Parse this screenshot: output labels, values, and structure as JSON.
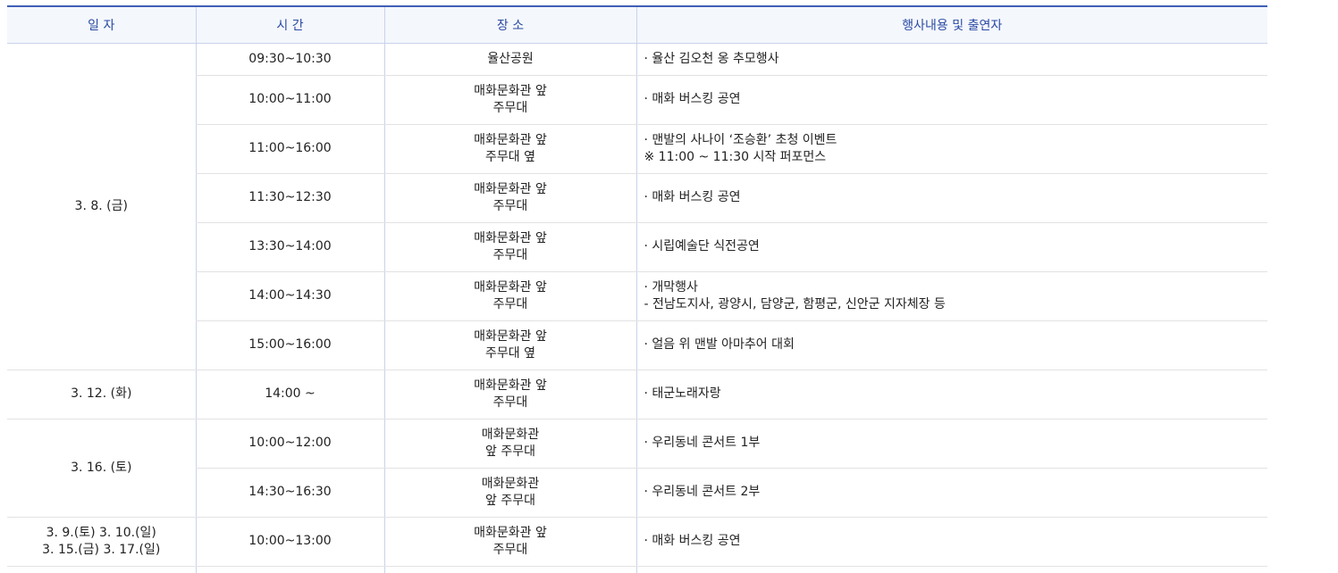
{
  "header": {
    "date": "일 자",
    "time": "시 간",
    "place": "장 소",
    "event": "행사내용 및 출연자"
  },
  "rows": [
    {
      "date": "3. 8. (금)",
      "time": "09:30~10:30",
      "place": [
        "율산공원"
      ],
      "event": [
        "· 율산 김오천 옹 추모행사"
      ]
    },
    {
      "time": "10:00~11:00",
      "place": [
        "매화문화관 앞",
        "주무대"
      ],
      "event": [
        "· 매화 버스킹 공연"
      ]
    },
    {
      "time": "11:00~16:00",
      "place": [
        "매화문화관 앞",
        "주무대 옆"
      ],
      "event": [
        "· 맨발의 사나이 ‘조승환’ 초청 이벤트",
        "※ 11:00 ~ 11:30 시작 퍼포먼스"
      ]
    },
    {
      "time": "11:30~12:30",
      "place": [
        "매화문화관 앞",
        "주무대"
      ],
      "event": [
        "· 매화 버스킹 공연"
      ]
    },
    {
      "time": "13:30~14:00",
      "place": [
        "매화문화관 앞",
        "주무대"
      ],
      "event": [
        "· 시립예술단 식전공연"
      ]
    },
    {
      "time": "14:00~14:30",
      "place": [
        "매화문화관 앞",
        "주무대"
      ],
      "event": [
        "· 개막행사",
        "- 전남도지사, 광양시, 담양군, 함평군, 신안군 지자체장 등"
      ]
    },
    {
      "time": "15:00~16:00",
      "place": [
        "매화문화관 앞",
        "주무대 옆"
      ],
      "event": [
        "· 얼음 위 맨발 아마추어 대회"
      ]
    },
    {
      "date": "3. 12. (화)",
      "time": "14:00 ~",
      "place": [
        "매화문화관 앞",
        "주무대"
      ],
      "event": [
        "· 태군노래자랑"
      ]
    },
    {
      "date": "3. 16. (토)",
      "time": "10:00~12:00",
      "place": [
        "매화문화관",
        "앞 주무대"
      ],
      "event": [
        "· 우리동네 콘서트 1부"
      ]
    },
    {
      "time": "14:30~16:30",
      "place": [
        "매화문화관",
        "앞 주무대"
      ],
      "event": [
        "· 우리동네 콘서트 2부"
      ]
    },
    {
      "date": [
        "3. 9.(토) 3. 10.(일)",
        "3. 15.(금) 3. 17.(일)"
      ],
      "time": "10:00~13:00",
      "place": [
        "매화문화관 앞",
        "주무대"
      ],
      "event": [
        "· 매화 버스킹 공연"
      ]
    }
  ]
}
